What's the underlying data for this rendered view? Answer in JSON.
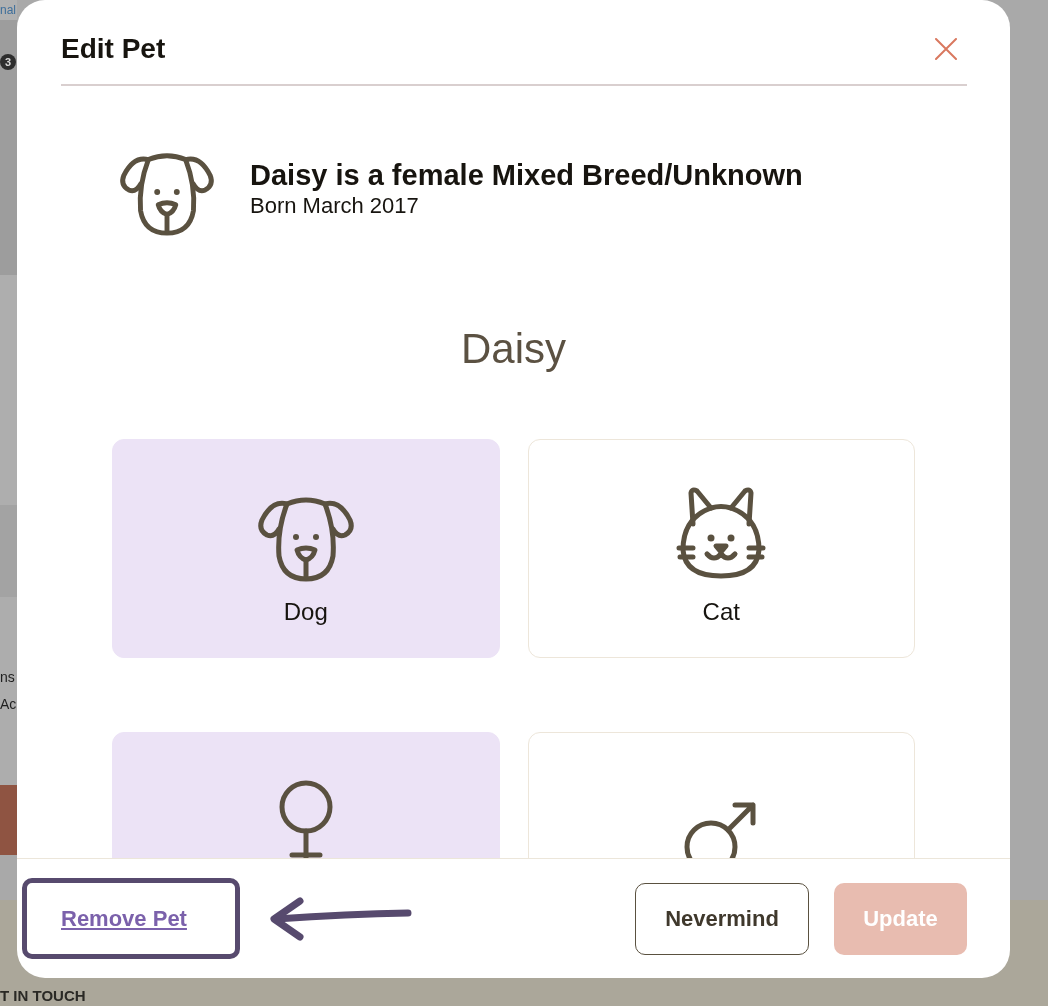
{
  "background": {
    "link_fragment": "nal",
    "badge": "3",
    "side_texts": [
      "ns",
      "Ac"
    ],
    "footer_heading": "T IN TOUCH"
  },
  "dialog": {
    "title": "Edit Pet"
  },
  "summary": {
    "headline": "Daisy is a female Mixed Breed/Unknown",
    "born": "Born March 2017"
  },
  "pet_name": "Daisy",
  "species_options": [
    {
      "kind": "dog",
      "label": "Dog",
      "selected": true
    },
    {
      "kind": "cat",
      "label": "Cat",
      "selected": false
    }
  ],
  "sex_options": [
    {
      "kind": "female",
      "selected": true
    },
    {
      "kind": "male",
      "selected": false
    }
  ],
  "footer": {
    "remove_link": "Remove Pet",
    "buttons": [
      {
        "kind": "secondary",
        "label": "Nevermind",
        "disabled": false
      },
      {
        "kind": "primary",
        "label": "Update",
        "disabled": true
      }
    ]
  }
}
